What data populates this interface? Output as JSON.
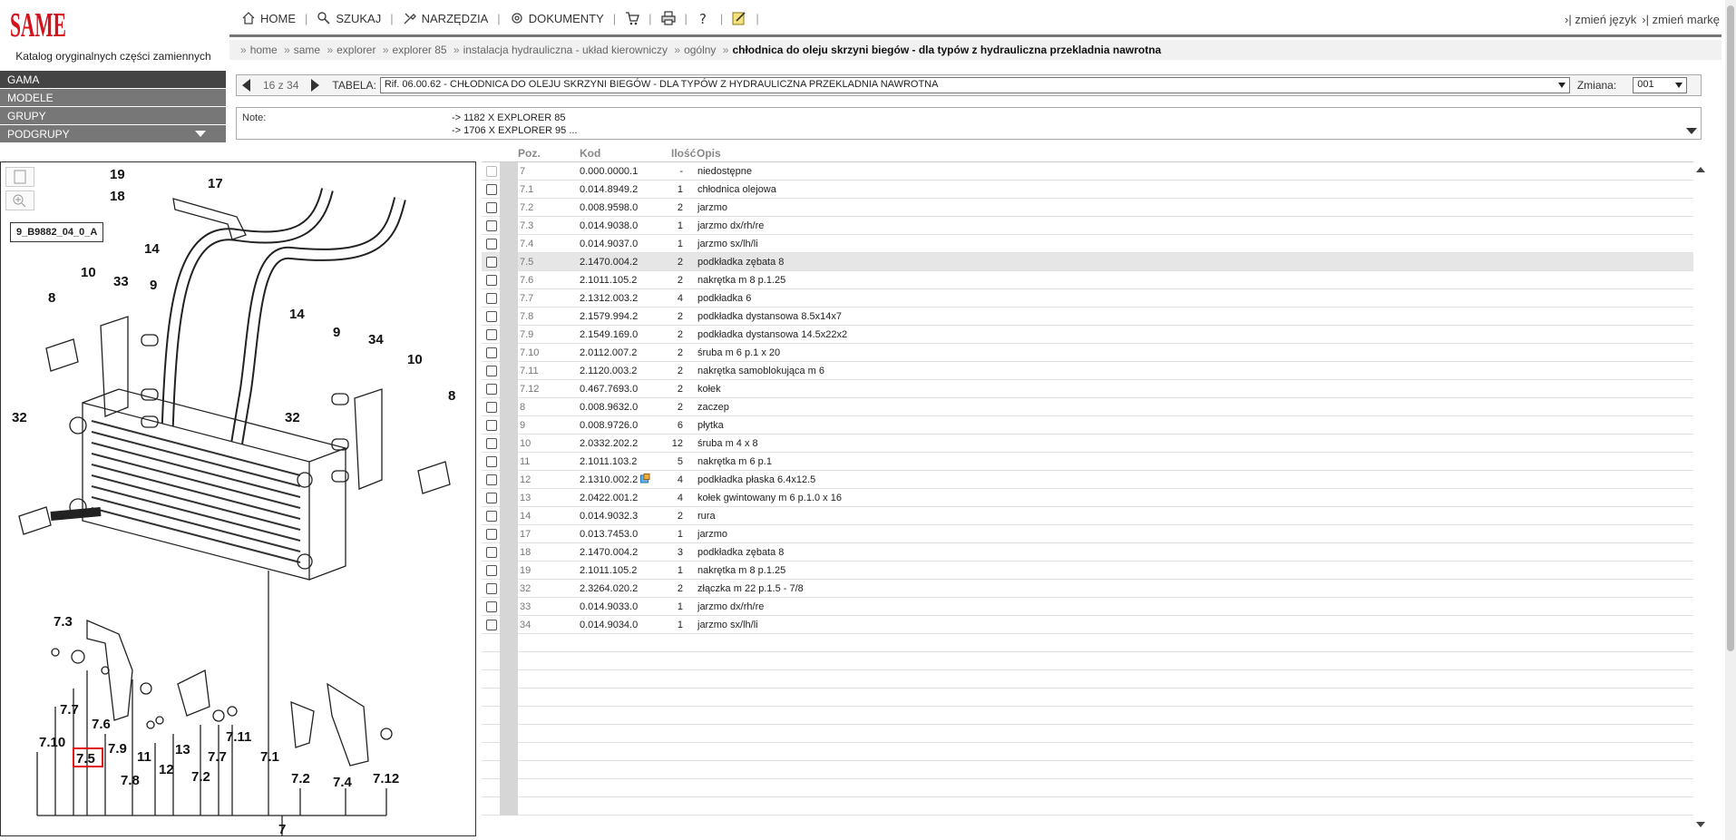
{
  "brand": {
    "logo_text": "SAME",
    "accent": "#d5121b"
  },
  "catalog_title": "Katalog oryginalnych części zamiennych",
  "nav": [
    {
      "label": "HOME",
      "icon": "home-icon"
    },
    {
      "label": "SZUKAJ",
      "icon": "search-icon"
    },
    {
      "label": "NARZĘDZIA",
      "icon": "tools-icon"
    },
    {
      "label": "DOKUMENTY",
      "icon": "documents-icon"
    }
  ],
  "nav_right": {
    "language": "zmień język",
    "brand": "zmień markę"
  },
  "breadcrumb": [
    "home",
    "same",
    "explorer",
    "explorer 85",
    "instalacja hydrauliczna - układ kierowniczy",
    "ogólny"
  ],
  "breadcrumb_current": "chłodnica do oleju skrzyni biegów - dla typów z hydrauliczna przekladnia nawrotna",
  "sidebar": [
    {
      "label": "GAMA"
    },
    {
      "label": "MODELE"
    },
    {
      "label": "GRUPY"
    },
    {
      "label": "PODGRUPY"
    }
  ],
  "toolbar": {
    "pager": "16 z 34",
    "table_label": "TABELA:",
    "table_value": "Rif. 06.00.62 - CHŁODNICA DO OLEJU SKRZYNI BIEGÓW - DLA TYPÓW Z HYDRAULICZNA PRZEKLADNIA NAWROTNA",
    "zmiana_label": "Zmiana:",
    "zmiana_value": "001"
  },
  "notes": {
    "label": "Note:",
    "lines": [
      "-> 1182 X EXPLORER 85",
      "-> 1706 X EXPLORER 95 ..."
    ]
  },
  "figure_code": "9_B9882_04_0_A",
  "drawing_labels": {
    "l19": "19",
    "l17": "17",
    "l18": "18",
    "l14a": "14",
    "l14b": "14",
    "l10a": "10",
    "l33": "33",
    "l9a": "9",
    "l8a": "8",
    "l9b": "9",
    "l34": "34",
    "l10b": "10",
    "l8b": "8",
    "l32a": "32",
    "l32b": "32",
    "l73": "7.3",
    "l77a": "7.7",
    "l76": "7.6",
    "l79": "7.9",
    "l13": "13",
    "l711": "7.11",
    "l710": "7.10",
    "l75": "7.5",
    "l11": "11",
    "l12": "12",
    "l77b": "7.7",
    "l71": "7.1",
    "l78": "7.8",
    "l72a": "7.2",
    "l72b": "7.2",
    "l74": "7.4",
    "l712": "7.12",
    "l7": "7"
  },
  "table_headers": {
    "poz": "Poz.",
    "kod": "Kod",
    "ilosc": "Ilość",
    "opis": "Opis"
  },
  "parts": [
    {
      "poz": "7",
      "kod": "0.000.0000.1",
      "ilosc": "-",
      "opis": "niedostępne"
    },
    {
      "poz": "7.1",
      "kod": "0.014.8949.2",
      "ilosc": "1",
      "opis": "chłodnica olejowa"
    },
    {
      "poz": "7.2",
      "kod": "0.008.9598.0",
      "ilosc": "2",
      "opis": "jarzmo"
    },
    {
      "poz": "7.3",
      "kod": "0.014.9038.0",
      "ilosc": "1",
      "opis": "jarzmo dx/rh/re"
    },
    {
      "poz": "7.4",
      "kod": "0.014.9037.0",
      "ilosc": "1",
      "opis": "jarzmo sx/lh/li"
    },
    {
      "poz": "7.5",
      "kod": "2.1470.004.2",
      "ilosc": "2",
      "opis": "podkładka zębata 8"
    },
    {
      "poz": "7.6",
      "kod": "2.1011.105.2",
      "ilosc": "2",
      "opis": "nakrętka m 8 p.1.25"
    },
    {
      "poz": "7.7",
      "kod": "2.1312.003.2",
      "ilosc": "4",
      "opis": "podkładka 6"
    },
    {
      "poz": "7.8",
      "kod": "2.1579.994.2",
      "ilosc": "2",
      "opis": "podkładka dystansowa 8.5x14x7"
    },
    {
      "poz": "7.9",
      "kod": "2.1549.169.0",
      "ilosc": "2",
      "opis": "podkładka dystansowa 14.5x22x2"
    },
    {
      "poz": "7.10",
      "kod": "2.0112.007.2",
      "ilosc": "2",
      "opis": "śruba m 6 p.1 x 20"
    },
    {
      "poz": "7.11",
      "kod": "2.1120.003.2",
      "ilosc": "2",
      "opis": "nakrętka samoblokująca m 6"
    },
    {
      "poz": "7.12",
      "kod": "0.467.7693.0",
      "ilosc": "2",
      "opis": "kołek"
    },
    {
      "poz": "8",
      "kod": "0.008.9632.0",
      "ilosc": "2",
      "opis": "zaczep"
    },
    {
      "poz": "9",
      "kod": "0.008.9726.0",
      "ilosc": "6",
      "opis": "płytka"
    },
    {
      "poz": "10",
      "kod": "2.0332.202.2",
      "ilosc": "12",
      "opis": "śruba m 4 x 8"
    },
    {
      "poz": "11",
      "kod": "2.1011.103.2",
      "ilosc": "5",
      "opis": "nakrętka m 6 p.1"
    },
    {
      "poz": "12",
      "kod": "2.1310.002.2",
      "ilosc": "4",
      "opis": "podkładka płaska 6.4x12.5"
    },
    {
      "poz": "13",
      "kod": "2.0422.001.2",
      "ilosc": "4",
      "opis": "kołek gwintowany m 6 p.1.0 x 16"
    },
    {
      "poz": "14",
      "kod": "0.014.9032.3",
      "ilosc": "2",
      "opis": "rura"
    },
    {
      "poz": "17",
      "kod": "0.013.7453.0",
      "ilosc": "1",
      "opis": "jarzmo"
    },
    {
      "poz": "18",
      "kod": "2.1470.004.2",
      "ilosc": "3",
      "opis": "podkładka zębata 8"
    },
    {
      "poz": "19",
      "kod": "2.1011.105.2",
      "ilosc": "1",
      "opis": "nakrętka m 8 p.1.25"
    },
    {
      "poz": "32",
      "kod": "2.3264.020.2",
      "ilosc": "2",
      "opis": "złączka m 22 p.1.5 - 7/8"
    },
    {
      "poz": "33",
      "kod": "0.014.9033.0",
      "ilosc": "1",
      "opis": "jarzmo dx/rh/re"
    },
    {
      "poz": "34",
      "kod": "0.014.9034.0",
      "ilosc": "1",
      "opis": "jarzmo sx/lh/li"
    }
  ],
  "selected_part": "7.5",
  "empty_rows": 10
}
